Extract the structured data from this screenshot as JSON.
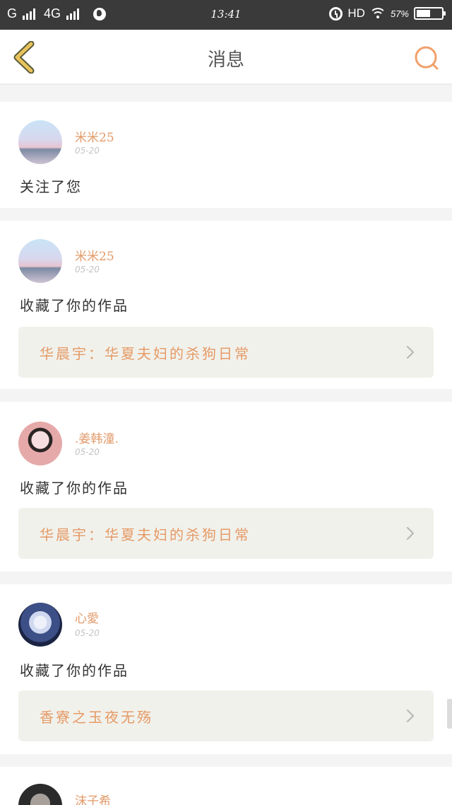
{
  "status_bar": {
    "carrier1": "G",
    "carrier2": "4G",
    "time": "13:41",
    "hd": "HD",
    "battery_pct": "57%",
    "battery_level": 0.57,
    "icons": [
      "signal-icon",
      "globe-icon",
      "alarm-icon",
      "wifi-icon",
      "battery-icon"
    ]
  },
  "nav": {
    "title": "消息",
    "back_icon": "chevron-left-icon",
    "search_icon": "search-icon",
    "accent_color": "#e8b450",
    "search_color": "#f2a06b"
  },
  "messages": [
    {
      "user": "米米25",
      "date": "05-20",
      "action": "关注了您",
      "avatar": "sky"
    },
    {
      "user": "米米25",
      "date": "05-20",
      "action": "收藏了你的作品",
      "avatar": "sky",
      "work": "华晨宇：华夏夫妇的杀狗日常"
    },
    {
      "user": ".姜韩潼.",
      "date": "05-20",
      "action": "收藏了你的作品",
      "avatar": "girl",
      "work": "华晨宇：华夏夫妇的杀狗日常"
    },
    {
      "user": "心愛",
      "date": "05-20",
      "action": "收藏了你的作品",
      "avatar": "fairy",
      "work": "香寮之玉夜无殇"
    },
    {
      "user": "沫子希",
      "avatar": "dark"
    }
  ]
}
